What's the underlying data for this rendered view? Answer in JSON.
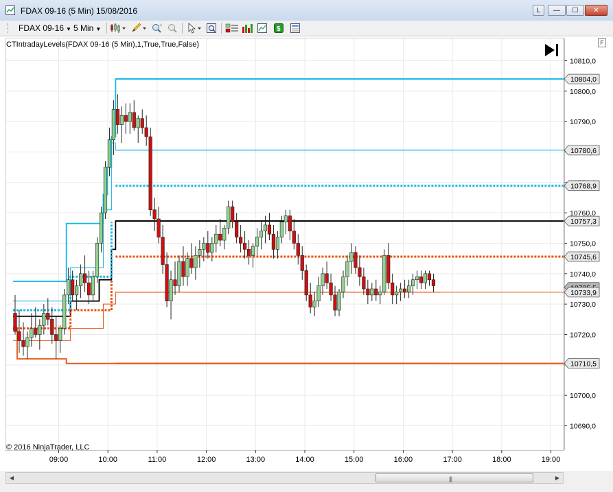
{
  "window": {
    "title": "FDAX 09-16 (5 Min)  15/08/2016",
    "buttons": {
      "l": "L",
      "minimize": "—",
      "maximize": "☐",
      "close": "✕"
    }
  },
  "toolbar": {
    "instrument": "FDAX 09-16",
    "interval": "5 Min"
  },
  "chart": {
    "indicator_label": "CTIntradayLevels(FDAX 09-16 (5 Min),1,True,True,False)",
    "copyright": "© 2016 NinjaTrader, LLC",
    "f_label": "F",
    "scroll_grip": "|||"
  },
  "chart_data": {
    "type": "candlestick",
    "ylim": [
      10685,
      10820
    ],
    "y_ticks": [
      10690,
      10700,
      10710,
      10720,
      10730,
      10740,
      10750,
      10760,
      10770,
      10780,
      10790,
      10800,
      10810
    ],
    "y_tick_labels": [
      "10690,0",
      "10700,0",
      "10710,0",
      "10720,0",
      "10730,0",
      "10740,0",
      "10750,0",
      "10760,0",
      "10770,0",
      "10780,0",
      "10790,0",
      "10800,0",
      "10810,0"
    ],
    "x_ticks": [
      "09:00",
      "10:00",
      "11:00",
      "12:00",
      "13:00",
      "14:00",
      "15:00",
      "16:00",
      "17:00",
      "18:00",
      "19:00"
    ],
    "grid": true,
    "colors": {
      "up": "#8fd18f",
      "down": "#cc1111",
      "cyan": "#15b7e8",
      "orange": "#e8500f",
      "black": "#000000"
    },
    "level_lines": [
      {
        "value": 10804.0,
        "label": "10804,0",
        "color": "#15b7e8",
        "style": "solid-thick"
      },
      {
        "value": 10780.6,
        "label": "10780,6",
        "color": "#15b7e8",
        "style": "solid-thin"
      },
      {
        "value": 10768.9,
        "label": "10768,9",
        "color": "#15b7e8",
        "style": "dotted"
      },
      {
        "value": 10757.3,
        "label": "10757,3",
        "color": "#000000",
        "style": "solid-thick"
      },
      {
        "value": 10745.6,
        "label": "10745,6",
        "color": "#e8500f",
        "style": "dotted"
      },
      {
        "value": 10735.5,
        "label": "10735,5",
        "color": "#888888",
        "style": "price"
      },
      {
        "value": 10733.9,
        "label": "10733,9",
        "color": "#e8500f",
        "style": "solid-thin"
      },
      {
        "value": 10710.5,
        "label": "10710,5",
        "color": "#e8500f",
        "style": "solid-thick"
      }
    ],
    "candles": [
      [
        10727,
        10733,
        10720,
        10721
      ],
      [
        10721,
        10728,
        10714,
        10718
      ],
      [
        10718,
        10724,
        10713,
        10716
      ],
      [
        10716,
        10721,
        10712,
        10719
      ],
      [
        10719,
        10727,
        10716,
        10722
      ],
      [
        10722,
        10729,
        10719,
        10720
      ],
      [
        10720,
        10725,
        10715,
        10723
      ],
      [
        10723,
        10730,
        10720,
        10727
      ],
      [
        10727,
        10732,
        10723,
        10725
      ],
      [
        10725,
        10729,
        10717,
        10720
      ],
      [
        10720,
        10726,
        10712,
        10718
      ],
      [
        10718,
        10723,
        10714,
        10722
      ],
      [
        10722,
        10735,
        10720,
        10733
      ],
      [
        10733,
        10742,
        10730,
        10738
      ],
      [
        10738,
        10741,
        10731,
        10733
      ],
      [
        10733,
        10738,
        10728,
        10736
      ],
      [
        10736,
        10743,
        10732,
        10740
      ],
      [
        10740,
        10746,
        10734,
        10737
      ],
      [
        10737,
        10741,
        10730,
        10733
      ],
      [
        10733,
        10741,
        10731,
        10739
      ],
      [
        10739,
        10752,
        10737,
        10750
      ],
      [
        10750,
        10762,
        10747,
        10760
      ],
      [
        10760,
        10777,
        10758,
        10775
      ],
      [
        10775,
        10788,
        10772,
        10784
      ],
      [
        10784,
        10797,
        10779,
        10794
      ],
      [
        10794,
        10799,
        10786,
        10789
      ],
      [
        10789,
        10795,
        10783,
        10792
      ],
      [
        10792,
        10796,
        10786,
        10790
      ],
      [
        10790,
        10796,
        10786,
        10793
      ],
      [
        10793,
        10797,
        10787,
        10788
      ],
      [
        10788,
        10792,
        10783,
        10791
      ],
      [
        10791,
        10794,
        10786,
        10788
      ],
      [
        10788,
        10792,
        10782,
        10785
      ],
      [
        10785,
        10788,
        10759,
        10761
      ],
      [
        10761,
        10765,
        10754,
        10758
      ],
      [
        10758,
        10762,
        10750,
        10752
      ],
      [
        10752,
        10756,
        10740,
        10743
      ],
      [
        10743,
        10747,
        10729,
        10731
      ],
      [
        10731,
        10741,
        10725,
        10738
      ],
      [
        10738,
        10744,
        10733,
        10736
      ],
      [
        10736,
        10746,
        10734,
        10744
      ],
      [
        10744,
        10749,
        10736,
        10739
      ],
      [
        10739,
        10747,
        10736,
        10745
      ],
      [
        10745,
        10750,
        10740,
        10742
      ],
      [
        10742,
        10749,
        10738,
        10746
      ],
      [
        10746,
        10751,
        10742,
        10748
      ],
      [
        10748,
        10752,
        10744,
        10750
      ],
      [
        10750,
        10754,
        10745,
        10747
      ],
      [
        10747,
        10752,
        10744,
        10750
      ],
      [
        10750,
        10756,
        10747,
        10753
      ],
      [
        10753,
        10758,
        10749,
        10751
      ],
      [
        10751,
        10756,
        10748,
        10755
      ],
      [
        10755,
        10764,
        10753,
        10762
      ],
      [
        10762,
        10764,
        10755,
        10757
      ],
      [
        10757,
        10760,
        10750,
        10752
      ],
      [
        10752,
        10756,
        10747,
        10750
      ],
      [
        10750,
        10754,
        10745,
        10748
      ],
      [
        10748,
        10751,
        10743,
        10746
      ],
      [
        10746,
        10750,
        10742,
        10749
      ],
      [
        10749,
        10755,
        10746,
        10752
      ],
      [
        10752,
        10757,
        10748,
        10754
      ],
      [
        10754,
        10759,
        10750,
        10756
      ],
      [
        10756,
        10760,
        10751,
        10753
      ],
      [
        10753,
        10756,
        10745,
        10748
      ],
      [
        10748,
        10754,
        10745,
        10752
      ],
      [
        10752,
        10759,
        10750,
        10757
      ],
      [
        10757,
        10761,
        10753,
        10759
      ],
      [
        10759,
        10761,
        10751,
        10754
      ],
      [
        10754,
        10758,
        10748,
        10750
      ],
      [
        10750,
        10753,
        10743,
        10746
      ],
      [
        10746,
        10749,
        10738,
        10741
      ],
      [
        10741,
        10743,
        10731,
        10733
      ],
      [
        10733,
        10737,
        10727,
        10729
      ],
      [
        10729,
        10734,
        10726,
        10731
      ],
      [
        10731,
        10739,
        10729,
        10736
      ],
      [
        10736,
        10742,
        10733,
        10740
      ],
      [
        10740,
        10744,
        10735,
        10737
      ],
      [
        10737,
        10740,
        10731,
        10733
      ],
      [
        10733,
        10736,
        10726,
        10728
      ],
      [
        10728,
        10735,
        10726,
        10734
      ],
      [
        10734,
        10741,
        10732,
        10739
      ],
      [
        10739,
        10746,
        10736,
        10744
      ],
      [
        10744,
        10750,
        10740,
        10747
      ],
      [
        10747,
        10749,
        10740,
        10742
      ],
      [
        10742,
        10746,
        10736,
        10739
      ],
      [
        10739,
        10742,
        10733,
        10735
      ],
      [
        10735,
        10738,
        10730,
        10733
      ],
      [
        10733,
        10737,
        10731,
        10735
      ],
      [
        10735,
        10738,
        10731,
        10733
      ],
      [
        10733,
        10736,
        10730,
        10734
      ],
      [
        10734,
        10748,
        10733,
        10746
      ],
      [
        10746,
        10750,
        10735,
        10737
      ],
      [
        10737,
        10740,
        10730,
        10733
      ],
      [
        10733,
        10736,
        10730,
        10734
      ],
      [
        10734,
        10737,
        10731,
        10735
      ],
      [
        10735,
        10738,
        10732,
        10734
      ],
      [
        10734,
        10738,
        10732,
        10736
      ],
      [
        10736,
        10740,
        10733,
        10738
      ],
      [
        10738,
        10741,
        10735,
        10739
      ],
      [
        10739,
        10741,
        10735,
        10737
      ],
      [
        10737,
        10741,
        10735,
        10740
      ],
      [
        10740,
        10741,
        10736,
        10738
      ],
      [
        10738,
        10740,
        10734,
        10736
      ]
    ]
  }
}
